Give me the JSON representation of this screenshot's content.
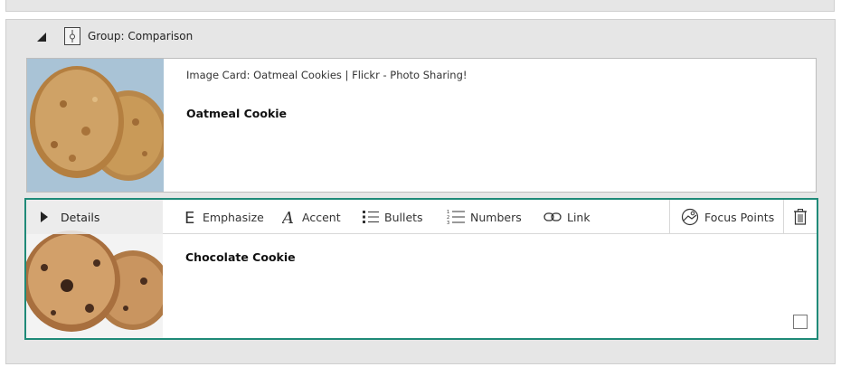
{
  "group": {
    "title": "Group: Comparison"
  },
  "cards": [
    {
      "meta": "Image Card: Oatmeal Cookies | Flickr - Photo Sharing!",
      "heading": "Oatmeal Cookie",
      "image_icon": "oatmeal-cookie-photo"
    },
    {
      "heading": "Chocolate Cookie",
      "image_icon": "chocolate-cookie-photo",
      "details_label": "Details",
      "toolbar": {
        "emphasize": "Emphasize",
        "accent": "Accent",
        "bullets": "Bullets",
        "numbers": "Numbers",
        "link": "Link",
        "focus_points": "Focus Points"
      }
    }
  ],
  "colors": {
    "selected_border": "#1f8a78",
    "panel_bg": "#e6e6e6"
  }
}
